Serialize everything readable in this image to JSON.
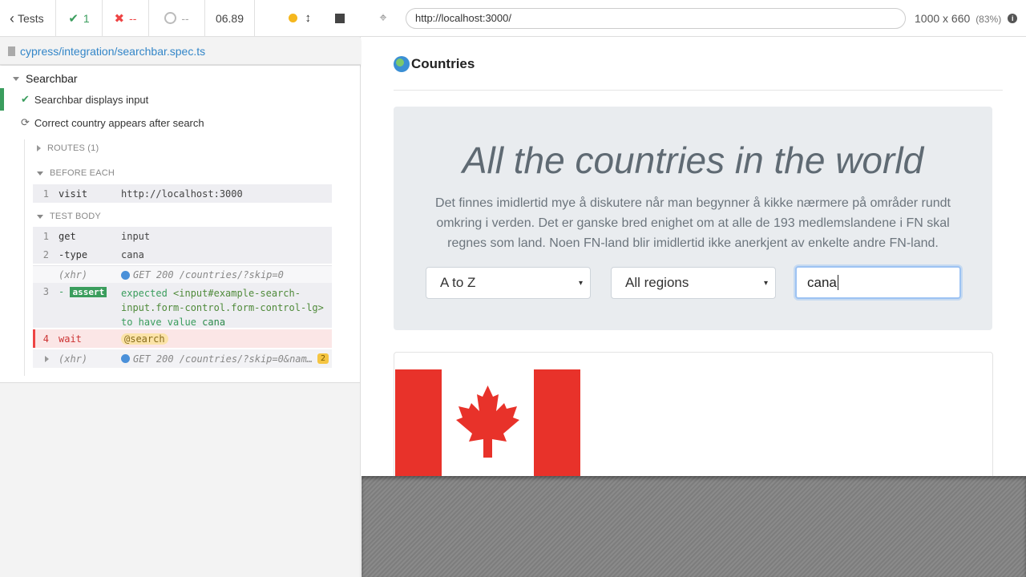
{
  "reporter": {
    "tests_label": "Tests",
    "passed": "1",
    "failed": "--",
    "pending": "--",
    "duration": "06.89",
    "spec_path": "cypress/integration/searchbar.spec.ts",
    "suite": "Searchbar",
    "tests": [
      {
        "title": "Searchbar displays input",
        "state": "passed"
      },
      {
        "title": "Correct country appears after search",
        "state": "running"
      }
    ],
    "routes_label": "ROUTES (1)",
    "before_each_label": "BEFORE EACH",
    "test_body_label": "TEST BODY",
    "commands": {
      "visit": {
        "num": "1",
        "name": "visit",
        "msg": "http://localhost:3000"
      },
      "get": {
        "num": "1",
        "name": "get",
        "msg": "input"
      },
      "type": {
        "num": "2",
        "name": "-type",
        "msg": "cana"
      },
      "xhr1": {
        "name": "(xhr)",
        "msg": "GET 200 /countries/?skip=0"
      },
      "assert": {
        "num": "3",
        "name": "-",
        "badge": "assert",
        "expected": "expected",
        "selector": "<input#example-search-input.form-control.form-control-lg>",
        "to_have": "to have value",
        "value": "cana"
      },
      "wait": {
        "num": "4",
        "name": "wait",
        "msg": "@search"
      },
      "xhr2": {
        "name": "(xhr)",
        "msg": "GET 200 /countries/?skip=0&nam…",
        "count": "2"
      }
    }
  },
  "aut_header": {
    "url": "http://localhost:3000/",
    "viewport": "1000 x 660",
    "scale": "(83%)"
  },
  "app": {
    "brand": "Countries",
    "heading": "All the countries in the world",
    "intro": "Det finnes imidlertid mye å diskutere når man begynner å kikke nærmere på områder rundt omkring i verden. Det er ganske bred enighet om at alle de 193 medlemslandene i FN skal regnes som land. Noen FN-land blir imidlertid ikke anerkjent av enkelte andre FN-land.",
    "sort_value": "A to Z",
    "region_value": "All regions",
    "search_value": "cana"
  },
  "colors": {
    "pass": "#3a9d5d",
    "fail": "#e44444",
    "link": "#3386c8",
    "flag_red": "#e8322a"
  }
}
